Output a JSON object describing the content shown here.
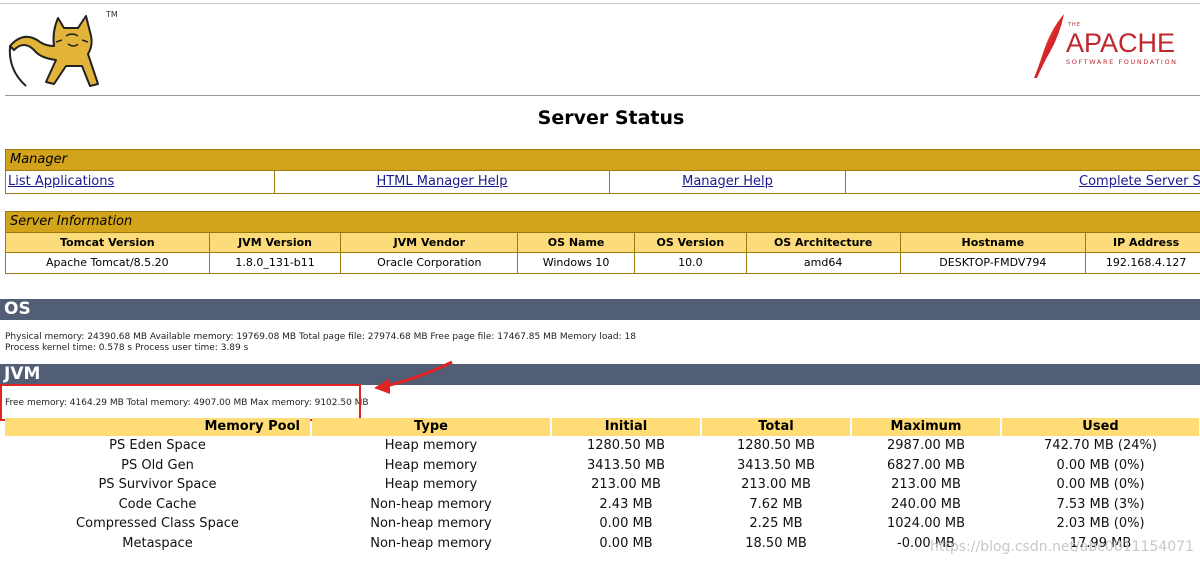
{
  "header": {
    "tomcat_tm": "TM",
    "apache_the": "THE",
    "apache_name": "APACHE",
    "apache_sub": "SOFTWARE FOUNDATION",
    "title": "Server Status"
  },
  "manager": {
    "heading": "Manager",
    "links": [
      "List Applications",
      "HTML Manager Help",
      "Manager Help",
      "Complete Server Status"
    ]
  },
  "server_info": {
    "heading": "Server Information",
    "columns": [
      "Tomcat Version",
      "JVM Version",
      "JVM Vendor",
      "OS Name",
      "OS Version",
      "OS Architecture",
      "Hostname",
      "IP Address"
    ],
    "values": [
      "Apache Tomcat/8.5.20",
      "1.8.0_131-b11",
      "Oracle Corporation",
      "Windows 10",
      "10.0",
      "amd64",
      "DESKTOP-FMDV794",
      "192.168.4.127"
    ]
  },
  "os": {
    "heading": "OS",
    "line1": "Physical memory: 24390.68 MB Available memory: 19769.08 MB Total page file: 27974.68 MB Free page file: 17467.85 MB Memory load: 18",
    "line2": "Process kernel time: 0.578 s Process user time: 3.89 s"
  },
  "jvm": {
    "heading": "JVM",
    "memory_line": "Free memory: 4164.29 MB Total memory: 4907.00 MB Max memory: 9102.50 MB"
  },
  "memory_pools": {
    "columns": [
      "Memory Pool",
      "Type",
      "Initial",
      "Total",
      "Maximum",
      "Used"
    ],
    "rows": [
      [
        "PS Eden Space",
        "Heap memory",
        "1280.50 MB",
        "1280.50 MB",
        "2987.00 MB",
        "742.70 MB (24%)"
      ],
      [
        "PS Old Gen",
        "Heap memory",
        "3413.50 MB",
        "3413.50 MB",
        "6827.00 MB",
        "0.00 MB (0%)"
      ],
      [
        "PS Survivor Space",
        "Heap memory",
        "213.00 MB",
        "213.00 MB",
        "213.00 MB",
        "0.00 MB (0%)"
      ],
      [
        "Code Cache",
        "Non-heap memory",
        "2.43 MB",
        "7.62 MB",
        "240.00 MB",
        "7.53 MB (3%)"
      ],
      [
        "Compressed Class Space",
        "Non-heap memory",
        "0.00 MB",
        "2.25 MB",
        "1024.00 MB",
        "2.03 MB (0%)"
      ],
      [
        "Metaspace",
        "Non-heap memory",
        "0.00 MB",
        "18.50 MB",
        "-0.00 MB",
        "17.99 MB"
      ]
    ]
  },
  "watermark": "https://blog.csdn.net/abc0011154071",
  "colors": {
    "table_header": "#d2a41c",
    "column_header": "#fcdc7a",
    "section_bar": "#525d76",
    "highlight_box": "#e02424"
  }
}
